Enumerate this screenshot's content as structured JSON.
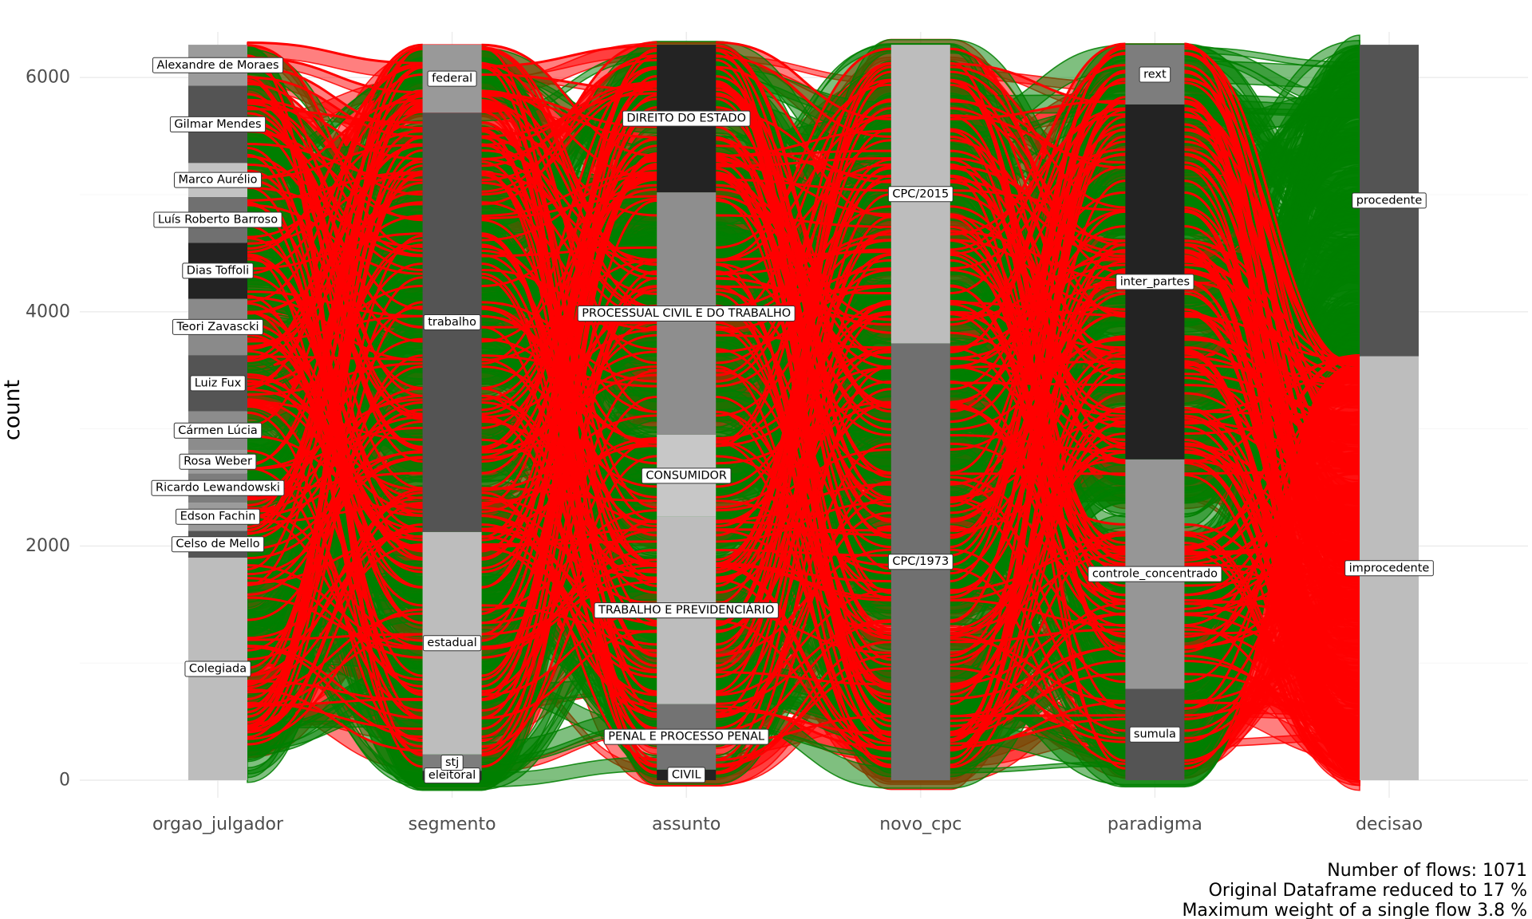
{
  "chart_data": {
    "type": "alluvial",
    "ylabel": "count",
    "xlabel": "",
    "ylim": [
      0,
      6300
    ],
    "yticks": [
      0,
      2000,
      4000,
      6000
    ],
    "flow_colors": {
      "procedente": "#007f00",
      "improcedente": "#ff0000"
    },
    "axes": [
      {
        "name": "orgao_julgador",
        "strata": [
          {
            "label": "Colegiada",
            "value": 1900,
            "color": "#bdbdbd"
          },
          {
            "label": "Celso de Mello",
            "value": 230,
            "color": "#545454"
          },
          {
            "label": "Edson Fachin",
            "value": 240,
            "color": "#9b9b9b"
          },
          {
            "label": "Ricardo Lewandowski",
            "value": 250,
            "color": "#7d7d7d"
          },
          {
            "label": "Rosa Weber",
            "value": 200,
            "color": "#9e9e9e"
          },
          {
            "label": "Cármen Lúcia",
            "value": 330,
            "color": "#8c8c8c"
          },
          {
            "label": "Luiz Fux",
            "value": 480,
            "color": "#545454"
          },
          {
            "label": "Teori Zavascki",
            "value": 480,
            "color": "#8a8a8a"
          },
          {
            "label": "Dias Toffoli",
            "value": 480,
            "color": "#232323"
          },
          {
            "label": "Luís Roberto Barroso",
            "value": 390,
            "color": "#707070"
          },
          {
            "label": "Marco Aurélio",
            "value": 290,
            "color": "#c2c2c2"
          },
          {
            "label": "Gilmar Mendes",
            "value": 660,
            "color": "#545454"
          },
          {
            "label": "Alexandre de Moraes",
            "value": 350,
            "color": "#9b9b9b"
          }
        ]
      },
      {
        "name": "segmento",
        "strata": [
          {
            "label": "eleitoral",
            "value": 80,
            "color": "#2e2e2e"
          },
          {
            "label": "stj",
            "value": 140,
            "color": "#7d7d7d"
          },
          {
            "label": "estadual",
            "value": 1900,
            "color": "#bdbdbd"
          },
          {
            "label": "trabalho",
            "value": 3580,
            "color": "#545454"
          },
          {
            "label": "federal",
            "value": 580,
            "color": "#999999"
          }
        ]
      },
      {
        "name": "assunto",
        "strata": [
          {
            "label": "CIVIL",
            "value": 90,
            "color": "#232323"
          },
          {
            "label": "PENAL E PROCESSO PENAL",
            "value": 560,
            "color": "#737373"
          },
          {
            "label": "TRABALHO E PREVIDENCIÁRIO",
            "value": 1600,
            "color": "#bdbdbd"
          },
          {
            "label": "CONSUMIDOR",
            "value": 700,
            "color": "#c7c7c7"
          },
          {
            "label": "PROCESSUAL CIVIL E DO TRABALHO",
            "value": 2070,
            "color": "#8e8e8e"
          },
          {
            "label": "DIREITO DO ESTADO",
            "value": 1260,
            "color": "#232323"
          }
        ]
      },
      {
        "name": "novo_cpc",
        "strata": [
          {
            "label": "CPC/1973",
            "value": 3730,
            "color": "#707070"
          },
          {
            "label": "CPC/2015",
            "value": 2550,
            "color": "#bdbdbd"
          }
        ]
      },
      {
        "name": "paradigma",
        "strata": [
          {
            "label": "sumula",
            "value": 780,
            "color": "#545454"
          },
          {
            "label": "controle_concentrado",
            "value": 1960,
            "color": "#969696"
          },
          {
            "label": "inter_partes",
            "value": 3030,
            "color": "#232323"
          },
          {
            "label": "rext",
            "value": 510,
            "color": "#7d7d7d"
          }
        ]
      },
      {
        "name": "decisao",
        "strata": [
          {
            "label": "improcedente",
            "value": 3620,
            "color": "#bdbdbd"
          },
          {
            "label": "procedente",
            "value": 2660,
            "color": "#545454"
          }
        ]
      }
    ],
    "caption": [
      "Number of flows: 1071",
      "Original Dataframe reduced to 17 %",
      "Maximum weight of a single flow 3.8 %"
    ]
  }
}
